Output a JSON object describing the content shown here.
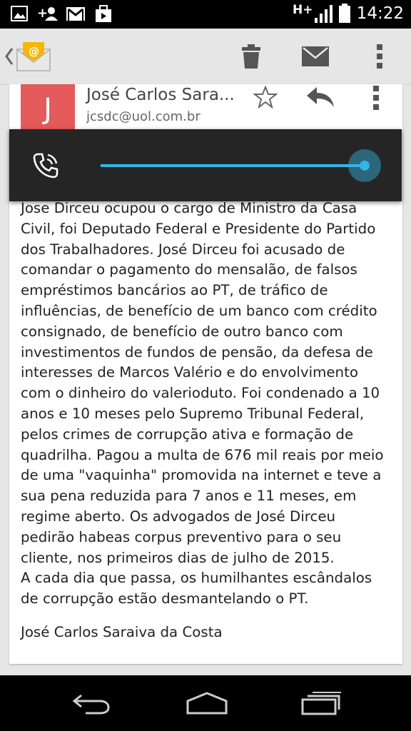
{
  "status_bar": {
    "network": "H+",
    "time": "14:22",
    "icons": [
      "image-icon",
      "add-contact-icon",
      "gmail-icon",
      "briefcase-icon",
      "signal-icon",
      "battery-icon"
    ]
  },
  "action_bar": {
    "icons": [
      "back-chevron-icon",
      "email-app-icon",
      "delete-icon",
      "mark-unread-icon",
      "overflow-menu-icon"
    ]
  },
  "message": {
    "avatar_letter": "J",
    "sender": "José Carlos Sara...",
    "email": "jcsdc@uol.com.br",
    "body": "Jose Dirceu ocupou o cargo de Ministro da Casa Civil, foi Deputado Federal e Presidente do Partido dos Trabalhadores. José Dirceu foi acusado de comandar o pagamento do mensalão, de falsos empréstimos bancários ao PT, de tráfico de influências, de benefício de um banco com crédito consignado, de benefício de outro banco com investimentos de fundos de pensão, da defesa de interesses de Marcos Valério e do envolvimento com o dinheiro do valerioduto. Foi condenado a 10 anos e 10 meses pelo Supremo Tribunal Federal, pelos crimes de corrupção ativa e formação de quadrilha. Pagou a multa de 676 mil reais por meio de uma \"vaquinha\" promovida na internet e teve a sua pena reduzida para 7 anos e 11 meses, em regime aberto. Os advogados de José Dirceu pedirão habeas corpus preventivo para o seu cliente, nos primeiros dias de julho de 2015.",
    "body2": "A cada dia que passa, os humilhantes escândalos de corrupção estão desmantelando o PT.",
    "signature": "José Carlos Saraiva da Costa"
  },
  "volume_overlay": {
    "icon": "phone-call-icon",
    "level": 1.0,
    "accent": "#33b5e5"
  },
  "nav_bar": {
    "icons": [
      "back-icon",
      "home-icon",
      "recents-icon"
    ]
  }
}
